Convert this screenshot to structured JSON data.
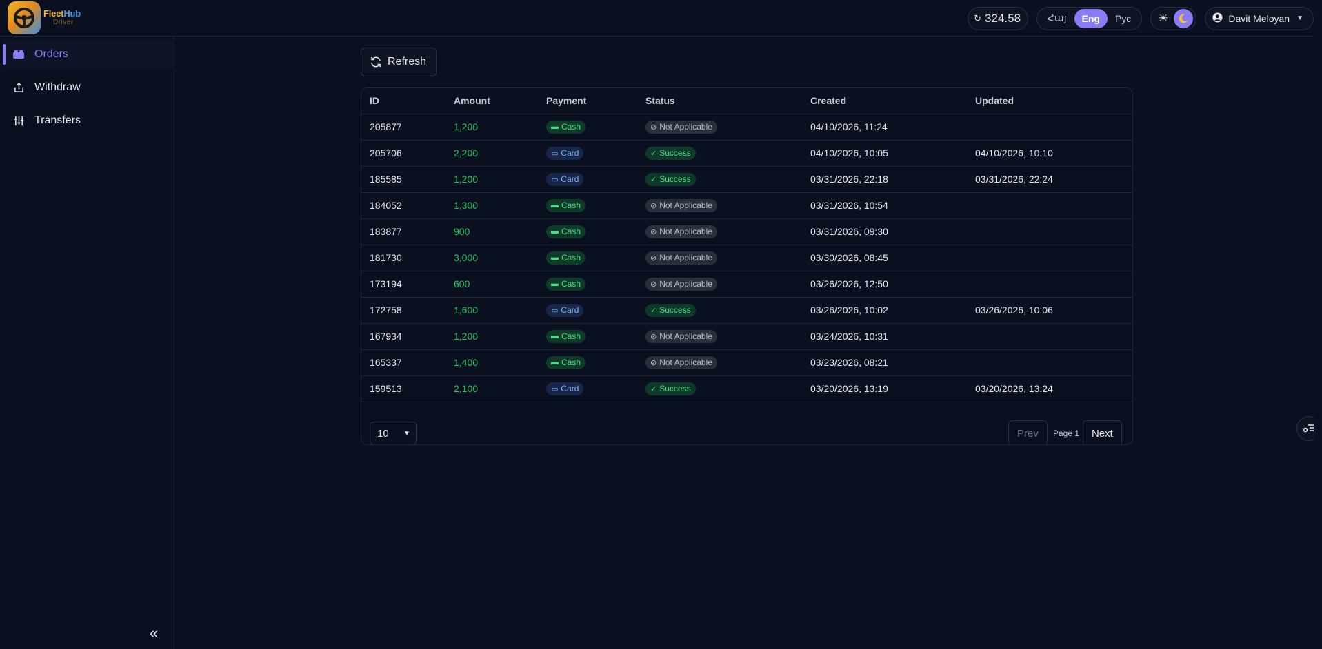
{
  "header": {
    "logo": {
      "brand_a": "Fleet",
      "brand_b": "Hub",
      "sub": "Driver"
    },
    "balance": {
      "value": "324.58"
    },
    "languages": [
      {
        "label": "Հայ",
        "active": false
      },
      {
        "label": "Eng",
        "active": true
      },
      {
        "label": "Рус",
        "active": false
      }
    ],
    "user": {
      "name": "Davit Meloyan"
    }
  },
  "sidebar": {
    "items": [
      {
        "label": "Orders",
        "icon": "orders-icon",
        "active": true
      },
      {
        "label": "Withdraw",
        "icon": "withdraw-icon",
        "active": false
      },
      {
        "label": "Transfers",
        "icon": "transfers-icon",
        "active": false
      }
    ]
  },
  "toolbar": {
    "refresh_label": "Refresh"
  },
  "table": {
    "columns": [
      "ID",
      "Amount",
      "Payment",
      "Status",
      "Created",
      "Updated"
    ],
    "rows": [
      {
        "id": "205877",
        "amount": "1,200",
        "payment": "Cash",
        "status": "Not Applicable",
        "created": "04/10/2026, 11:24",
        "updated": ""
      },
      {
        "id": "205706",
        "amount": "2,200",
        "payment": "Card",
        "status": "Success",
        "created": "04/10/2026, 10:05",
        "updated": "04/10/2026, 10:10"
      },
      {
        "id": "185585",
        "amount": "1,200",
        "payment": "Card",
        "status": "Success",
        "created": "03/31/2026, 22:18",
        "updated": "03/31/2026, 22:24"
      },
      {
        "id": "184052",
        "amount": "1,300",
        "payment": "Cash",
        "status": "Not Applicable",
        "created": "03/31/2026, 10:54",
        "updated": ""
      },
      {
        "id": "183877",
        "amount": "900",
        "payment": "Cash",
        "status": "Not Applicable",
        "created": "03/31/2026, 09:30",
        "updated": ""
      },
      {
        "id": "181730",
        "amount": "3,000",
        "payment": "Cash",
        "status": "Not Applicable",
        "created": "03/30/2026, 08:45",
        "updated": ""
      },
      {
        "id": "173194",
        "amount": "600",
        "payment": "Cash",
        "status": "Not Applicable",
        "created": "03/26/2026, 12:50",
        "updated": ""
      },
      {
        "id": "172758",
        "amount": "1,600",
        "payment": "Card",
        "status": "Success",
        "created": "03/26/2026, 10:02",
        "updated": "03/26/2026, 10:06"
      },
      {
        "id": "167934",
        "amount": "1,200",
        "payment": "Cash",
        "status": "Not Applicable",
        "created": "03/24/2026, 10:31",
        "updated": ""
      },
      {
        "id": "165337",
        "amount": "1,400",
        "payment": "Cash",
        "status": "Not Applicable",
        "created": "03/23/2026, 08:21",
        "updated": ""
      },
      {
        "id": "159513",
        "amount": "2,100",
        "payment": "Card",
        "status": "Success",
        "created": "03/20/2026, 13:19",
        "updated": "03/20/2026, 13:24"
      }
    ]
  },
  "pagination": {
    "page_size": "10",
    "prev_label": "Prev",
    "page_label": "Page 1",
    "next_label": "Next"
  },
  "colors": {
    "accent": "#8b7cf6",
    "amount": "#22c55e",
    "background": "#0b1020"
  }
}
